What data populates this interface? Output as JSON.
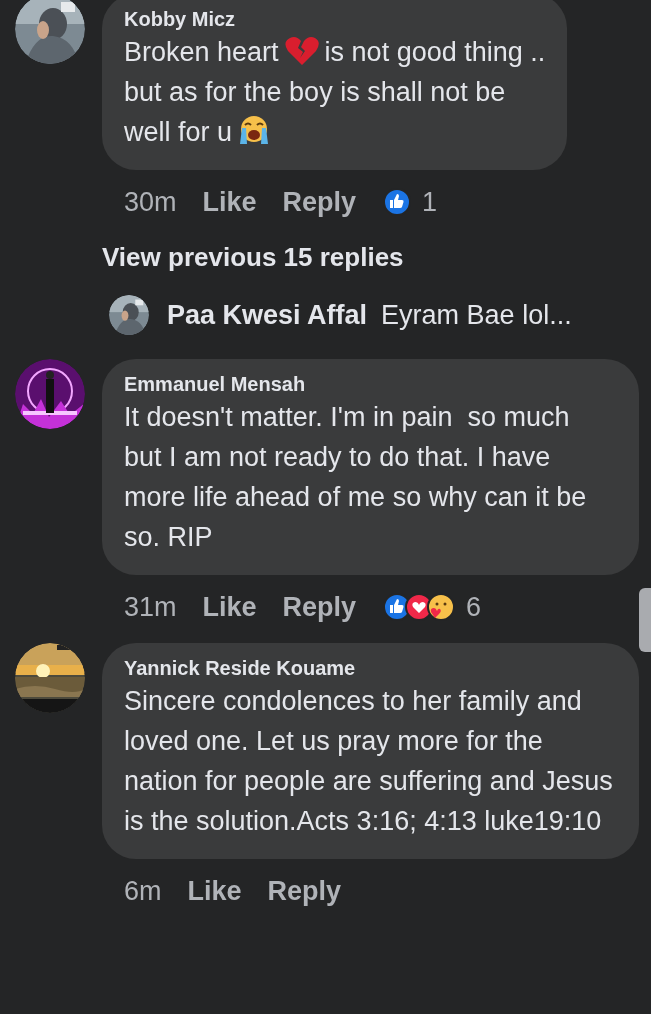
{
  "comments": [
    {
      "author": "Kobby Micz",
      "avatar": {
        "kind": "picture"
      },
      "lines": [
        {
          "parts": [
            {
              "kind": "text",
              "text": "Broken heart"
            },
            {
              "kind": "broken-heart"
            },
            {
              "kind": "text",
              "text": "is not good thing .."
            }
          ]
        },
        {
          "parts": [
            {
              "kind": "text",
              "text": "but as for the boy is shall not be"
            }
          ]
        },
        {
          "parts": [
            {
              "kind": "text",
              "text": "well for u"
            },
            {
              "kind": "crying-face"
            }
          ]
        }
      ],
      "time": "30m",
      "like": "Like",
      "reply": "Reply",
      "reactions": [
        {
          "kind": "like"
        }
      ],
      "reaction_count": "1",
      "more_replies": "View previous 15 replies",
      "reply_preview": {
        "author": "Paa Kwesi Affal",
        "text": "Eyram Bae lol..."
      }
    },
    {
      "author": "Emmanuel Mensah",
      "avatar": {
        "kind": "picture"
      },
      "text": "It doesn't matter. I'm in pain  so much  but I am not ready to do that. I have more life ahead of me so why can it be so. RIP",
      "time": "31m",
      "like": "Like",
      "reply": "Reply",
      "reactions": [
        {
          "kind": "like"
        },
        {
          "kind": "love"
        },
        {
          "kind": "care"
        }
      ],
      "reaction_count": "6"
    },
    {
      "author": "Yannick Reside Kouame",
      "avatar": {
        "kind": "picture"
      },
      "text": "Sincere condolences to her family and loved one. Let us pray more for the nation for people are suffering and Jesus is the solution.Acts 3:16; 4:13 luke19:10",
      "time": "6m",
      "like": "Like",
      "reply": "Reply"
    }
  ]
}
